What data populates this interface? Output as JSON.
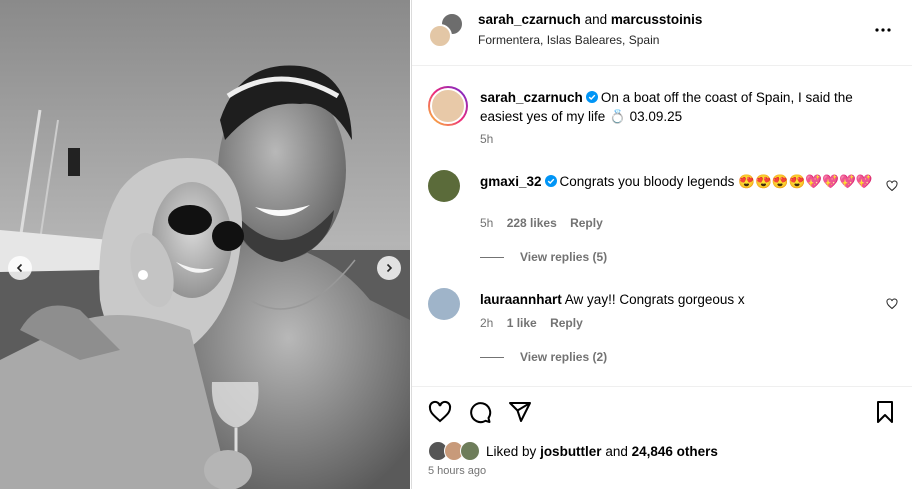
{
  "header": {
    "user1": "sarah_czarnuch",
    "and": "and",
    "user2": "marcusstoinis",
    "location": "Formentera, Islas Baleares, Spain"
  },
  "caption": {
    "username": "sarah_czarnuch",
    "text": "On a boat off the coast of Spain, I said the easiest yes of my life",
    "ring_emoji": "💍",
    "date": "03.09.25",
    "time": "5h"
  },
  "comments": [
    {
      "username": "gmaxi_32",
      "verified": true,
      "text": "Congrats you bloody legends",
      "emojis": "😍😍😍😍💖💖💖💖",
      "time": "5h",
      "likes": "228 likes",
      "reply": "Reply",
      "view_replies": "View replies (5)"
    },
    {
      "username": "lauraannhart",
      "verified": false,
      "text": "Aw yay!! Congrats gorgeous x",
      "time": "2h",
      "likes": "1 like",
      "reply": "Reply",
      "view_replies": "View replies (2)"
    }
  ],
  "likes": {
    "prefix": "Liked by",
    "user": "josbuttler",
    "and": "and",
    "others": "24,846 others"
  },
  "posted_ago": "5 hours ago",
  "colors": {
    "verified": "#0095f6",
    "secondary_text": "#737373",
    "heart_emoji": "#e8336d"
  }
}
